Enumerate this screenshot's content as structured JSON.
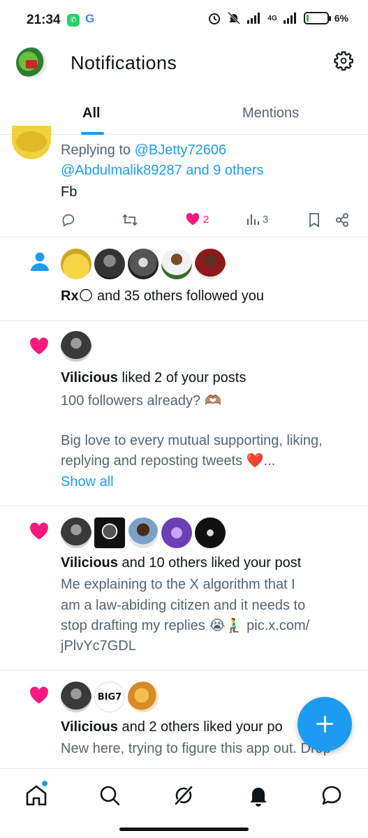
{
  "status_bar": {
    "time": "21:34",
    "whatsapp": "✆",
    "google": "G",
    "network": "4G",
    "battery_percent": "6%",
    "battery_level": 0.06
  },
  "header": {
    "title": "Notifications"
  },
  "tabs": [
    {
      "label": "All",
      "active": true
    },
    {
      "label": "Mentions",
      "active": false
    }
  ],
  "notifications": [
    {
      "type": "reply",
      "replying_prefix": "Replying to",
      "mentions_line1": "@BJetty72606",
      "mentions_line2": "@Abdulmalik89287 and 9 others",
      "text": "Fb",
      "likes": "2",
      "views": "3"
    },
    {
      "type": "follow",
      "actor": "Rx🌕",
      "text": " and 35 others followed you"
    },
    {
      "type": "like",
      "actor": "Vilicious",
      "text": " liked 2 of your posts",
      "post_line1": "100 followers already? 🫶🏽",
      "post_line2": "Big love to every mutual supporting, liking,",
      "post_line3": "replying and reposting tweets ❤️...",
      "show_all": "Show all"
    },
    {
      "type": "like",
      "actor": "Vilicious",
      "text": " and 10 others liked your post",
      "post_line1": "Me explaining to the X algorithm that I",
      "post_line2": "am a law-abiding citizen and it needs to",
      "post_line3": "stop drafting my replies 😭🧎‍♂️ pic.x.com/",
      "post_line4": "jPlvYc7GDL"
    },
    {
      "type": "like",
      "actor": "Vilicious",
      "text": " and 2 others liked your po",
      "post_line1": "New here, trying to figure this app out. Drop",
      "avatar_label": "BIG7"
    }
  ],
  "colors": {
    "accent": "#1d9bf0",
    "like": "#f91880",
    "text": "#0f1419",
    "muted": "#536471"
  },
  "icons": [
    "home-icon",
    "search-icon",
    "grok-icon",
    "bell-icon",
    "messages-icon",
    "compose-icon",
    "gear-icon"
  ]
}
